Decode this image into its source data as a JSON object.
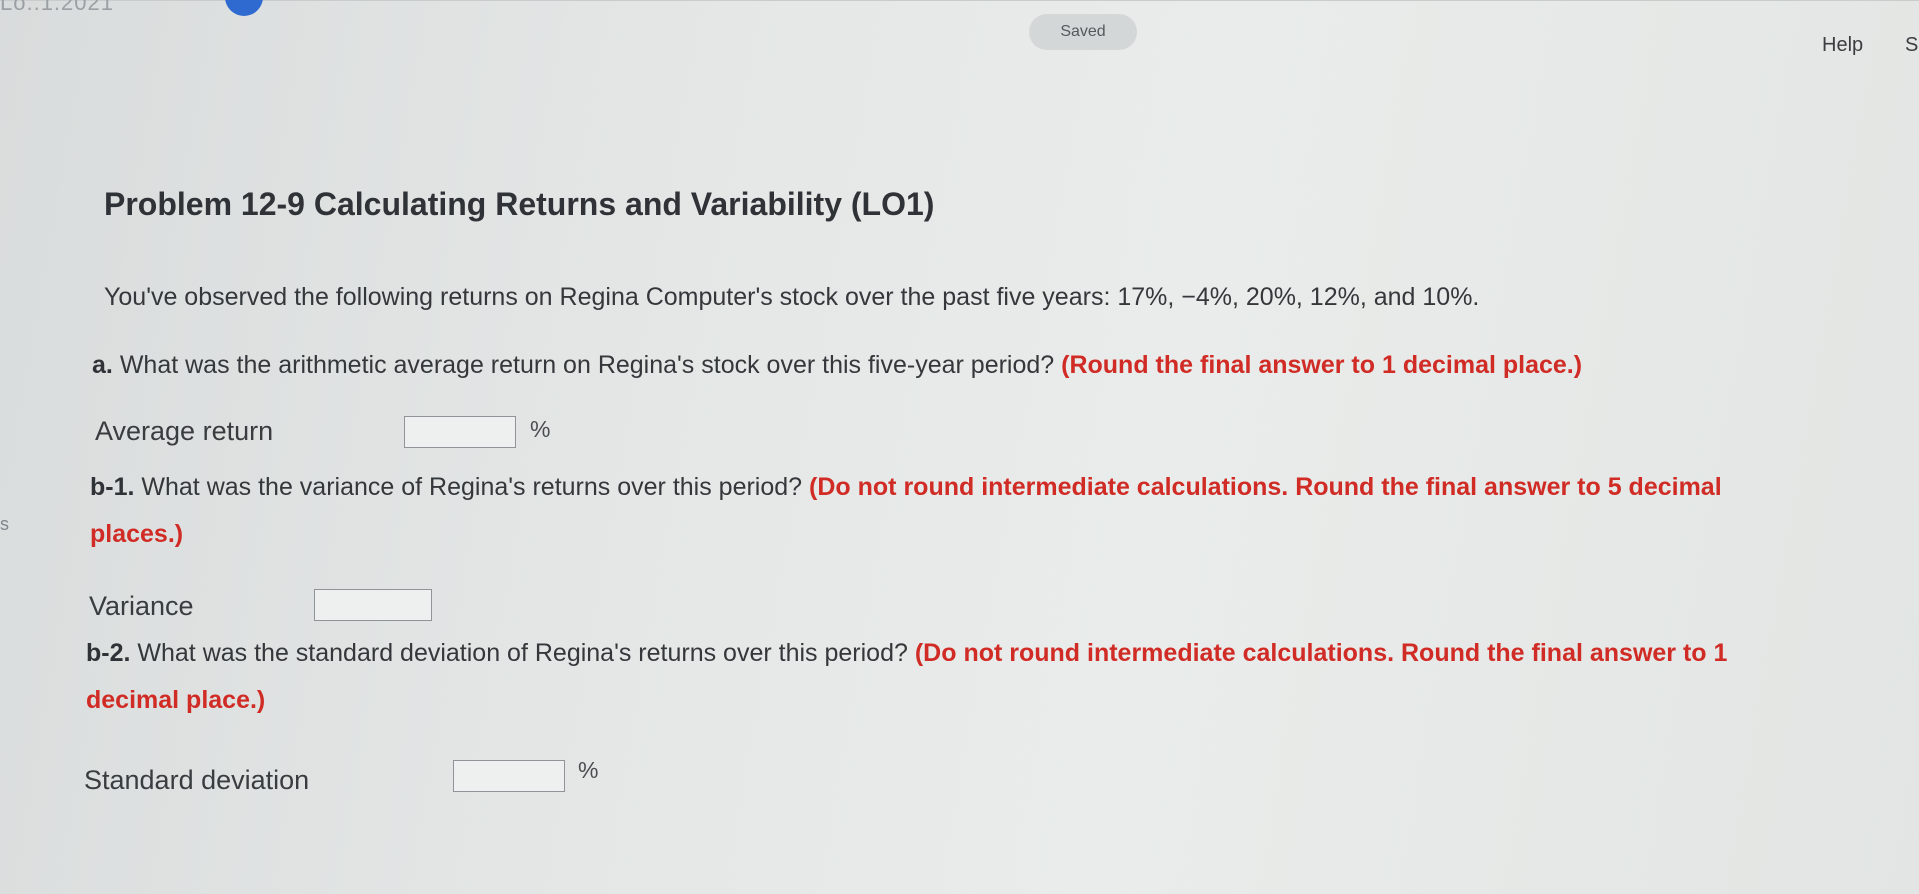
{
  "header": {
    "top_left_fragment": "Lo..1.2021",
    "saved_label": "Saved",
    "help_label": "Help",
    "cut_label": "Sa"
  },
  "left_marker": "s",
  "problem": {
    "title": "Problem 12-9 Calculating Returns and Variability (LO1)",
    "stem": "You've observed the following returns on Regina Computer's stock over the past five years: 17%, −4%, 20%, 12%, and 10%."
  },
  "questions": [
    {
      "number": "a.",
      "text": "What was the arithmetic average return on Regina's stock over this five-year period?",
      "instruction": "(Round the final answer to 1 decimal place.)",
      "field_label": "Average return",
      "value": "",
      "unit": "%"
    },
    {
      "number": "b-1.",
      "text": "What was the variance of Regina's returns over this period?",
      "instruction": "(Do not round intermediate calculations. Round the final answer to 5 decimal places.)",
      "field_label": "Variance",
      "value": "",
      "unit": ""
    },
    {
      "number": "b-2.",
      "text": "What was the standard deviation of Regina's returns over this period?",
      "instruction": "(Do not round intermediate calculations. Round the final answer to 1 decimal place.)",
      "field_label": "Standard deviation",
      "value": "",
      "unit": "%"
    }
  ]
}
